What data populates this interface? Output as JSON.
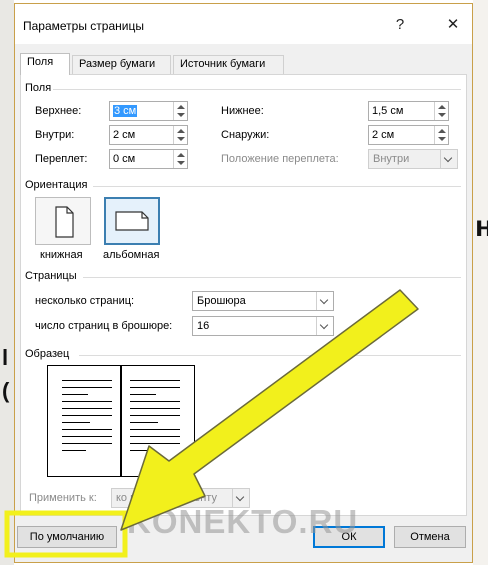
{
  "dialog": {
    "title": "Параметры страницы",
    "help_glyph": "?",
    "close_glyph": "✕"
  },
  "tabs": [
    "Поля",
    "Размер бумаги",
    "Источник бумаги"
  ],
  "margins": {
    "group_label": "Поля",
    "top_label": "Верхнее:",
    "top_value": "3 см",
    "bottom_label": "Нижнее:",
    "bottom_value": "1,5 см",
    "inside_label": "Внутри:",
    "inside_value": "2 см",
    "outside_label": "Снаружи:",
    "outside_value": "2 см",
    "gutter_label": "Переплет:",
    "gutter_value": "0 см",
    "gutter_pos_label": "Положение переплета:",
    "gutter_pos_value": "Внутри"
  },
  "orientation": {
    "group_label": "Ориентация",
    "portrait_label": "книжная",
    "landscape_label": "альбомная",
    "selected": "landscape"
  },
  "pages": {
    "group_label": "Страницы",
    "multiple_label": "несколько страниц:",
    "multiple_value": "Брошюра",
    "sheets_label": "число страниц в брошюре:",
    "sheets_value": "16"
  },
  "preview": {
    "group_label": "Образец"
  },
  "apply": {
    "label": "Применить к:",
    "value": "ко всему документу"
  },
  "buttons": {
    "default_label": "По умолчанию",
    "ok_label": "ОК",
    "cancel_label": "Отмена"
  },
  "watermark": "KONEKTO.RU",
  "background_text": {
    "right_char": "н",
    "left_chars": [
      "l",
      "("
    ]
  },
  "colors": {
    "accent": "#0078d7",
    "selection": "#3399ff",
    "arrow_fill": "#f2f01c",
    "dialog_bg": "#f0f0f0"
  }
}
